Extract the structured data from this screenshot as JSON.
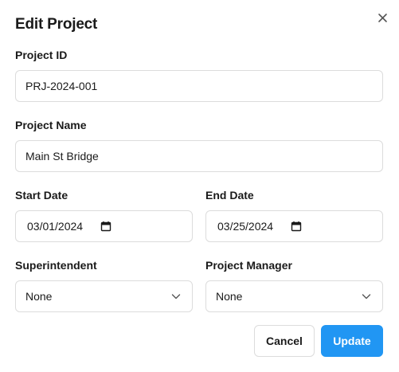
{
  "dialog": {
    "title": "Edit Project",
    "close_icon": "close-icon"
  },
  "fields": {
    "project_id": {
      "label": "Project ID",
      "value": "PRJ-2024-001"
    },
    "project_name": {
      "label": "Project Name",
      "value": "Main St Bridge"
    },
    "start_date": {
      "label": "Start Date",
      "value": "03/01/2024",
      "icon": "calendar-icon"
    },
    "end_date": {
      "label": "End Date",
      "value": "03/25/2024",
      "icon": "calendar-icon"
    },
    "superintendent": {
      "label": "Superintendent",
      "value": "None",
      "icon": "chevron-down-icon"
    },
    "project_manager": {
      "label": "Project Manager",
      "value": "None",
      "icon": "chevron-down-icon"
    }
  },
  "actions": {
    "cancel_label": "Cancel",
    "update_label": "Update"
  },
  "colors": {
    "accent": "#2196f3",
    "border": "#dcdcdc",
    "text": "#1a1a1a"
  }
}
